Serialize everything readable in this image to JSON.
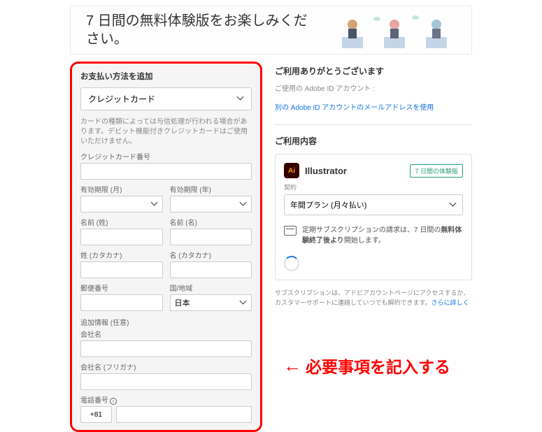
{
  "banner": {
    "text": "7 日間の無料体験版をお楽しみください。"
  },
  "form": {
    "heading": "お支払い方法を追加",
    "payment_type": "クレジットカード",
    "disclaimer": "カードの種類によっては与信処理が行われる場合があります。デビット機能付きクレジットカードはご使用いただけません。",
    "card_number_label": "クレジットカード番号",
    "expiry_month_label": "有効期限 (月)",
    "expiry_year_label": "有効期限 (年)",
    "last_name_label": "名前 (姓)",
    "first_name_label": "名前 (名)",
    "last_name_kana_label": "姓 (カタカナ)",
    "first_name_kana_label": "名 (カタカナ)",
    "postal_label": "郵便番号",
    "country_label": "国/地域",
    "country_value": "日本",
    "optional_heading": "追加情報 (任意)",
    "company_label": "会社名",
    "company_kana_label": "会社名 (フリガナ)",
    "phone_label": "電話番号",
    "phone_prefix": "+81"
  },
  "right": {
    "thanks": "ご利用ありがとうございます",
    "account_prefix": "ご使用の Adobe ID アカウント :",
    "other_account_link": "別の Adobe ID アカウントのメールアドレスを使用",
    "usage_heading": "ご利用内容",
    "product_name": "Illustrator",
    "trial_badge": "7 日間の体験版",
    "contract_label": "契約",
    "plan_value": "年間プラン (月々払い)",
    "subscription_note_1": "定期サブスクリプションの請求は、7 日間の",
    "subscription_note_2": "無料体験終了後より",
    "subscription_note_3": "開始します。",
    "footer_note": "サブスクリプションは、アドビアカウントページにアクセスするか、カスタマーサポートに連絡していつでも解約できます。",
    "footer_link": "さらに詳しく"
  },
  "annotation": {
    "text": "必要事項を記入する"
  }
}
